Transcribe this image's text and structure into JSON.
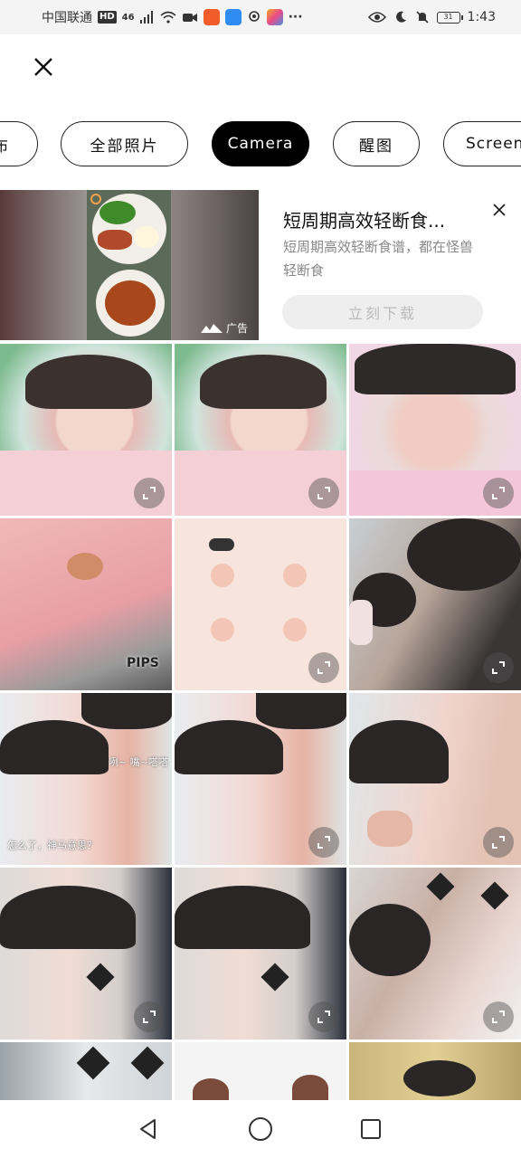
{
  "status_bar": {
    "carrier": "中国联通",
    "hd_badge": "HD",
    "network": "46",
    "time": "1:43",
    "battery": "31"
  },
  "albums": {
    "chips": [
      {
        "label": "布",
        "active": false
      },
      {
        "label": "全部照片",
        "active": false
      },
      {
        "label": "Camera",
        "active": true
      },
      {
        "label": "醒图",
        "active": false
      },
      {
        "label": "Screenshots",
        "active": false
      }
    ]
  },
  "ad": {
    "title": "短周期高效轻断食...",
    "description": "短周期高效轻断食谱，都在怪兽轻断食",
    "button_label": "立刻下载",
    "ad_label": "广告"
  },
  "grid": {
    "overlays": {
      "sticker": "PIPS",
      "caption_a": "咧~ 嘴~嗒嗒",
      "caption_b": "怎么了，神马意思？"
    }
  },
  "icons": {
    "close": "close-icon",
    "expand": "expand-icon",
    "back": "back-triangle-icon",
    "home": "home-circle-icon",
    "recent": "recent-square-icon"
  },
  "colors": {
    "active_chip_bg": "#000000",
    "button_disabled_bg": "#eeeeee"
  }
}
